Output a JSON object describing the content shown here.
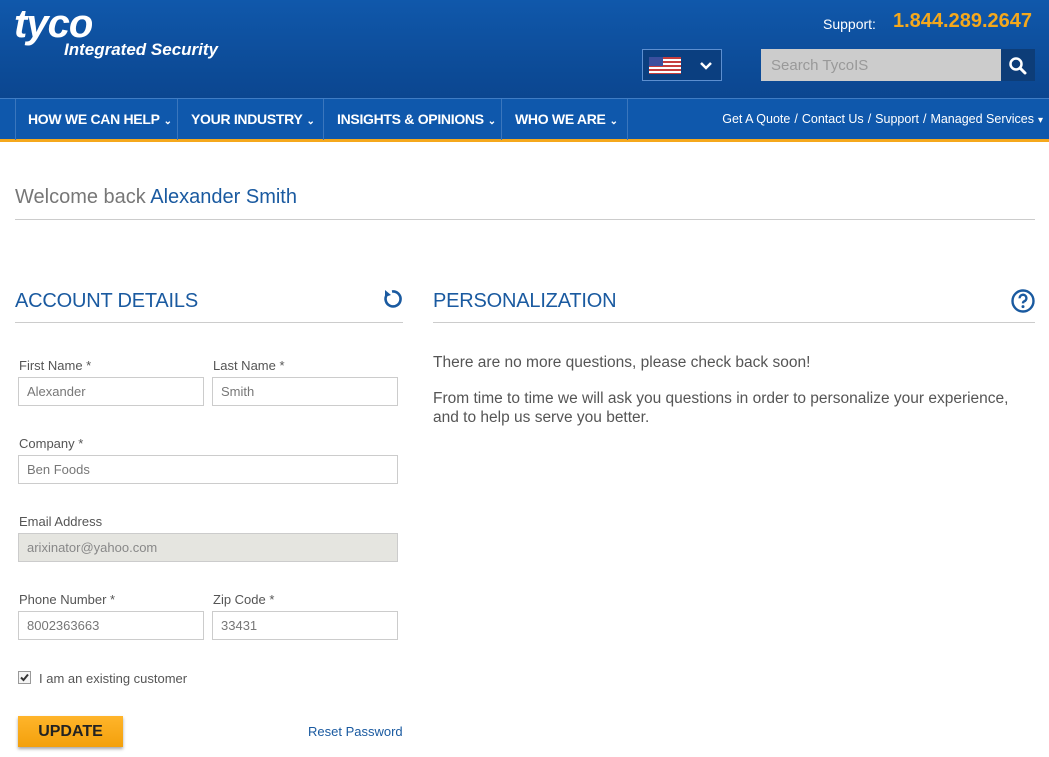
{
  "header": {
    "logo_main": "tyco",
    "logo_sub": "Integrated Security",
    "support_label": "Support:",
    "support_phone": "1.844.289.2647",
    "language_flag": "us-flag-icon",
    "search_placeholder": "Search TycoIS"
  },
  "nav": {
    "items": [
      {
        "label": "HOW WE CAN HELP"
      },
      {
        "label": "YOUR INDUSTRY"
      },
      {
        "label": "INSIGHTS & OPINIONS"
      },
      {
        "label": "WHO WE ARE"
      }
    ],
    "utility_links": [
      {
        "label": "Get A Quote"
      },
      {
        "label": "Contact Us"
      },
      {
        "label": "Support"
      },
      {
        "label": "Managed Services"
      }
    ]
  },
  "welcome": {
    "prefix": "Welcome back",
    "name": "Alexander Smith"
  },
  "account": {
    "title": "ACCOUNT DETAILS",
    "first_name_label": "First Name *",
    "first_name_value": "Alexander",
    "last_name_label": "Last Name *",
    "last_name_value": "Smith",
    "company_label": "Company *",
    "company_value": "Ben Foods",
    "email_label": "Email Address",
    "email_value": "arixinator@yahoo.com",
    "phone_label": "Phone Number *",
    "phone_value": "8002363663",
    "zip_label": "Zip Code *",
    "zip_value": "33431",
    "existing_customer_label": "I am an existing customer",
    "existing_customer_checked": true,
    "update_label": "UPDATE",
    "reset_label": "Reset Password"
  },
  "personalization": {
    "title": "PERSONALIZATION",
    "message1": "There are no more questions, please check back soon!",
    "message2": "From time to time we will ask you questions in order to personalize your experience, and to help us serve you better."
  },
  "colors": {
    "header_blue": "#0d4d9a",
    "nav_blue": "#0f58ac",
    "accent_orange": "#f5a81c",
    "link_blue": "#1a5aa0"
  }
}
